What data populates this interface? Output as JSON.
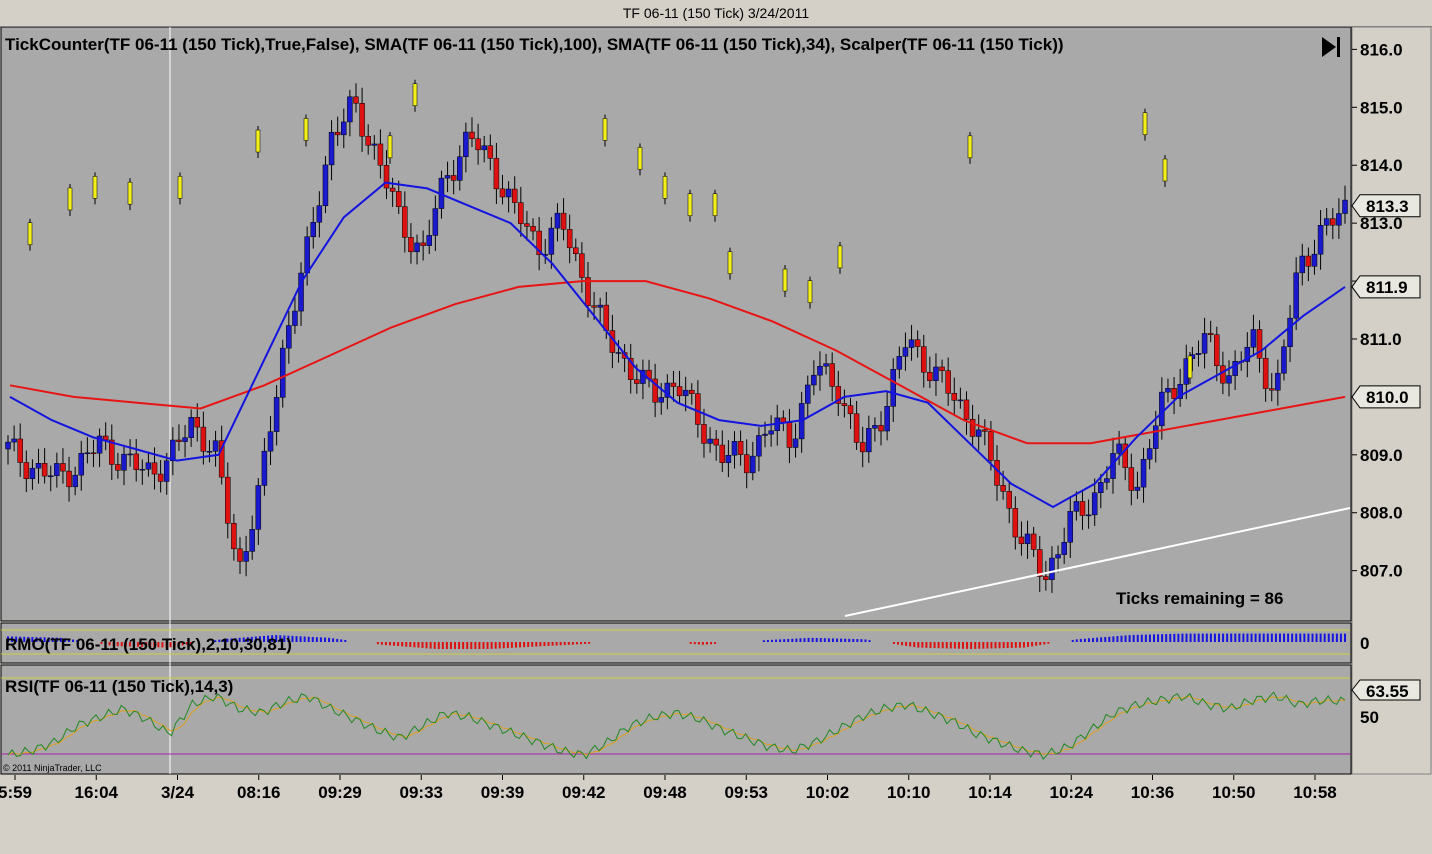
{
  "window": {
    "title": "TF 06-11 (150 Tick)  3/24/2011"
  },
  "panels": {
    "price": {
      "header": "TickCounter(TF 06-11 (150 Tick),True,False), SMA(TF 06-11 (150 Tick),100), SMA(TF 06-11 (150 Tick),34), Scalper(TF 06-11 (150 Tick))"
    },
    "rmo": {
      "header": "RMO(TF 06-11 (150 Tick),2,10,30,81)",
      "zero_label": "0"
    },
    "rsi": {
      "header": "RSI(TF 06-11 (150 Tick),14,3)",
      "mid_label": "50",
      "value_label": "63.55"
    }
  },
  "ticks_remaining": "Ticks remaining = 86",
  "copyright": "© 2011 NinjaTrader, LLC",
  "colors": {
    "background": "#a9a9a9",
    "up_candle": "#1a1acc",
    "down_candle": "#dd1111",
    "sma100": "#e81414",
    "sma34": "#1414e0",
    "scalper": "#f2ef1a",
    "rsi_line": "#228822",
    "rsi_signal": "#e0a020"
  },
  "chart_data": {
    "type": "candlestick",
    "y_axis": {
      "ylim": [
        806.2,
        816.3
      ],
      "ticks": [
        "816.0",
        "815.0",
        "814.0",
        "813.0",
        "812.0",
        "811.0",
        "810.0",
        "809.0",
        "808.0",
        "807.0"
      ],
      "price_markers": [
        {
          "label": "813.3",
          "value": 813.3
        },
        {
          "label": "811.9",
          "value": 811.9
        },
        {
          "label": "810.0",
          "value": 810.0
        }
      ]
    },
    "x_axis": {
      "tick_labels": [
        "5:59",
        "16:04",
        "3/24",
        "08:16",
        "09:29",
        "09:33",
        "09:39",
        "09:42",
        "09:48",
        "09:53",
        "10:02",
        "10:10",
        "10:14",
        "10:24",
        "10:36",
        "10:50",
        "10:58"
      ]
    },
    "candle_close_series": [
      809.1,
      808.8,
      808.6,
      808.8,
      809.2,
      808.9,
      808.7,
      808.9,
      809.6,
      809.0,
      807.0,
      808.5,
      811.0,
      812.5,
      814.5,
      815.0,
      814.2,
      813.0,
      812.5,
      813.8,
      814.5,
      814.0,
      813.2,
      812.6,
      813.0,
      812.0,
      811.0,
      810.5,
      810.0,
      810.3,
      809.5,
      809.0,
      808.9,
      809.5,
      809.3,
      810.5,
      810.2,
      809.0,
      809.8,
      811.0,
      810.5,
      810.0,
      809.5,
      808.5,
      807.5,
      806.9,
      807.8,
      808.2,
      809.0,
      808.5,
      809.8,
      810.5,
      811.0,
      810.3,
      811.0,
      810.0,
      812.3,
      812.8,
      813.3
    ],
    "sma34_series": [
      810.0,
      809.6,
      809.3,
      809.1,
      808.9,
      809.0,
      810.5,
      812.0,
      813.1,
      813.7,
      813.6,
      813.3,
      813.0,
      812.3,
      811.4,
      810.5,
      809.9,
      809.6,
      809.5,
      809.6,
      810.0,
      810.1,
      809.9,
      809.2,
      808.5,
      808.1,
      808.5,
      809.3,
      810.0,
      810.4,
      810.8,
      811.4,
      811.9
    ],
    "sma100_series": [
      810.2,
      810.0,
      809.9,
      809.8,
      810.2,
      810.7,
      811.2,
      811.6,
      811.9,
      812.0,
      812.0,
      811.7,
      811.3,
      810.8,
      810.2,
      809.6,
      809.2,
      809.2,
      809.4,
      809.6,
      809.8,
      810.0
    ],
    "scalper_marks": [
      812.8,
      813.4,
      813.6,
      813.5,
      813.6,
      814.4,
      814.6,
      814.3,
      815.2,
      814.6,
      814.1,
      813.6,
      813.3,
      813.3,
      812.3,
      812.0,
      811.8,
      812.4,
      814.3,
      814.7,
      813.9,
      810.5
    ],
    "rmo_levels": [
      0.4,
      0.3,
      -0.3,
      -0.4,
      0.2,
      0.5,
      0.3,
      -0.2,
      -0.5,
      -0.5,
      -0.3,
      -0.1,
      0.1,
      -0.2,
      0.1,
      0.3,
      0.2,
      -0.4,
      -0.5,
      -0.4,
      0.2,
      0.5,
      0.6,
      0.6,
      0.6,
      0.6
    ],
    "rsi": {
      "ylim": [
        30,
        75
      ],
      "series": [
        38,
        40,
        44,
        52,
        56,
        60,
        55,
        48,
        62,
        66,
        60,
        58,
        63,
        66,
        60,
        55,
        50,
        46,
        52,
        58,
        56,
        52,
        48,
        44,
        40,
        38,
        44,
        52,
        56,
        58,
        55,
        50,
        46,
        42,
        40,
        44,
        50,
        56,
        60,
        62,
        58,
        54,
        48,
        44,
        40,
        38,
        42,
        50,
        58,
        62,
        64,
        66,
        62,
        60,
        64,
        66,
        62,
        64,
        63.55
      ]
    }
  }
}
